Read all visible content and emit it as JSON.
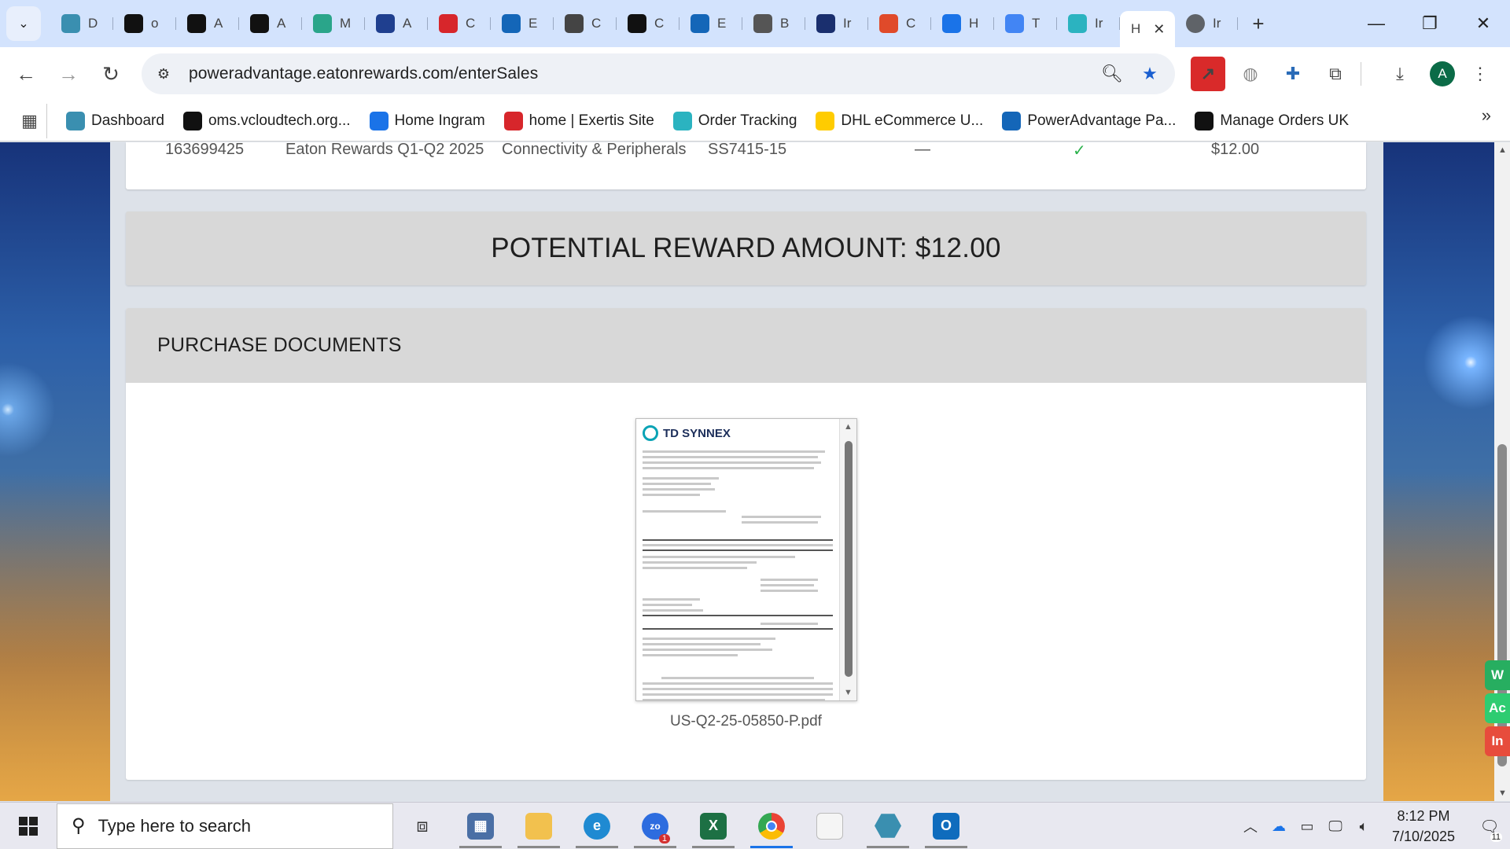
{
  "browser": {
    "tabs": [
      {
        "label": "D",
        "icon": "hexagon-icon",
        "color": "#3a8fb0"
      },
      {
        "label": "o",
        "icon": "triangle-logo-icon",
        "color": "#111111"
      },
      {
        "label": "A",
        "icon": "amazon-icon",
        "color": "#111111"
      },
      {
        "label": "A",
        "icon": "amazon-icon",
        "color": "#111111"
      },
      {
        "label": "M",
        "icon": "leaf-logo-icon",
        "color": "#2aa58a"
      },
      {
        "label": "A",
        "icon": "arrow-logo-icon",
        "color": "#1f3f8f"
      },
      {
        "label": "C",
        "icon": "exertis-icon",
        "color": "#d7262b"
      },
      {
        "label": "E",
        "icon": "e-logo-icon",
        "color": "#1466b8"
      },
      {
        "label": "C",
        "icon": "openai-icon",
        "color": "#444444"
      },
      {
        "label": "C",
        "icon": "openai-icon",
        "color": "#111111"
      },
      {
        "label": "E",
        "icon": "e-logo-icon",
        "color": "#1466b8"
      },
      {
        "label": "B",
        "icon": "bulb-icon",
        "color": "#555555"
      },
      {
        "label": "Ir",
        "icon": "bu-logo-icon",
        "color": "#1a2f6e"
      },
      {
        "label": "C",
        "icon": "layers-icon",
        "color": "#e04a2a"
      },
      {
        "label": "H",
        "icon": "ingram-icon",
        "color": "#1a73e8"
      },
      {
        "label": "T",
        "icon": "google-icon",
        "color": "#4285f4"
      },
      {
        "label": "Ir",
        "icon": "c-logo-icon",
        "color": "#2bb3c0"
      }
    ],
    "active_tab": {
      "label": "H"
    },
    "extra_tab": {
      "label": "Ir",
      "icon": "globe-icon",
      "color": "#5f6368"
    },
    "url": "poweradvantage.eatonrewards.com/enterSales",
    "bookmarks": [
      {
        "label": "Dashboard",
        "icon": "hexagon-icon",
        "color": "#3a8fb0"
      },
      {
        "label": "oms.vcloudtech.org...",
        "icon": "triangle-logo-icon",
        "color": "#111111"
      },
      {
        "label": "Home Ingram",
        "icon": "ingram-icon",
        "color": "#1a73e8"
      },
      {
        "label": "home | Exertis Site",
        "icon": "exertis-icon",
        "color": "#d7262b"
      },
      {
        "label": "Order Tracking",
        "icon": "c-logo-icon",
        "color": "#2bb3c0"
      },
      {
        "label": "DHL eCommerce U...",
        "icon": "dhl-icon",
        "color": "#ffcc00"
      },
      {
        "label": "PowerAdvantage Pa...",
        "icon": "document-icon",
        "color": "#1466b8"
      },
      {
        "label": "Manage Orders UK",
        "icon": "amazon-icon",
        "color": "#111111"
      }
    ],
    "avatar_letter": "A"
  },
  "page": {
    "table_row": {
      "id": "163699425",
      "program": "Eaton Rewards Q1-Q2 2025",
      "category": "Connectivity & Peripherals",
      "part": "SS7415-15",
      "dash": "—",
      "amount": "$12.00"
    },
    "reward_banner": "POTENTIAL REWARD AMOUNT: $12.00",
    "docs_heading": "PURCHASE DOCUMENTS",
    "document": {
      "logo_text": "TD SYNNEX",
      "filename": "US-Q2-25-05850-P.pdf"
    }
  },
  "taskbar": {
    "search_placeholder": "Type here to search",
    "time": "8:12 PM",
    "date": "7/10/2025",
    "zoom_badge": "1",
    "notif_count": "11"
  },
  "side_widget": [
    "W",
    "Ac",
    "In"
  ]
}
